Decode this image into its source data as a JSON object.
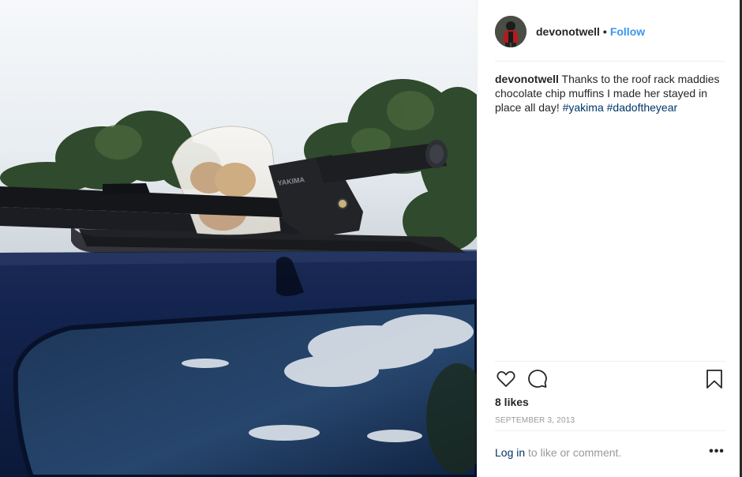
{
  "post": {
    "username": "devonotwell",
    "separator": "•",
    "follow_label": "Follow",
    "caption": {
      "username": "devonotwell",
      "text": "Thanks to the roof rack maddies chocolate chip muffins I made her stayed in place all day!",
      "hashtags": [
        "#yakima",
        "#dadoftheyear"
      ]
    },
    "likes_text": "8 likes",
    "date": "SEPTEMBER 3, 2013",
    "footer": {
      "login_label": "Log in",
      "rest_text": "to like or comment.",
      "more_label": "•••"
    },
    "icons": {
      "like": "heart-icon",
      "comment": "comment-icon",
      "save": "bookmark-icon",
      "more": "more-options-icon"
    },
    "colors": {
      "follow": "#3897f0",
      "hashtag": "#003569",
      "muted": "#999999",
      "text": "#262626"
    },
    "photo_text": "YAKIMA"
  }
}
